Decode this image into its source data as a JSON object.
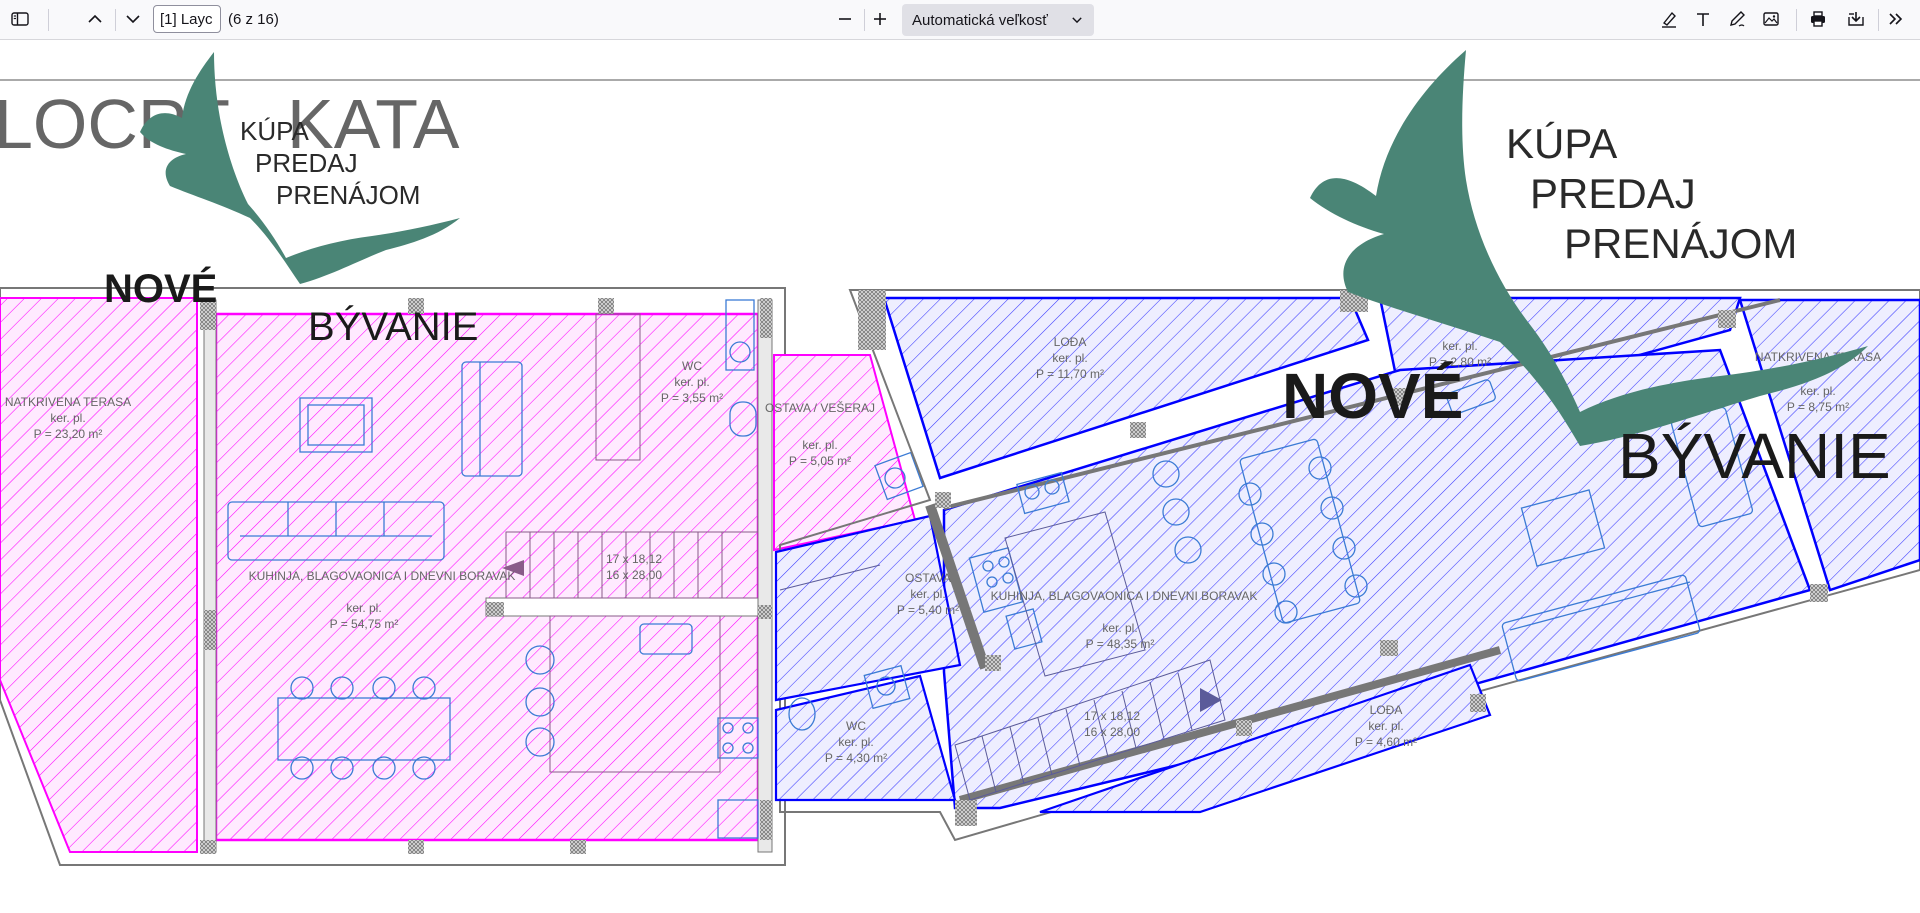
{
  "toolbar": {
    "sidebar_toggle_icon": "sidebar-icon",
    "prev_page_icon": "chevron-up-icon",
    "next_page_icon": "chevron-down-icon",
    "page_input_value": "[1] Layc",
    "page_count": "(6 z 16)",
    "zoom_out_icon": "minus-icon",
    "zoom_in_icon": "plus-icon",
    "zoom_value": "Automatická veľkosť",
    "right_tools": [
      "highlight-icon",
      "text-icon",
      "draw-icon",
      "image-icon",
      "print-icon",
      "save-icon",
      "more-tools-icon"
    ]
  },
  "document": {
    "partial_title": "LOCRT   KATA",
    "watermark": {
      "line1": "KÚPA",
      "line2": "PREDAJ",
      "line3": "PRENÁJOM",
      "brand1": "NOVÉ",
      "brand2": "BÝVANIE"
    },
    "rooms_left": [
      {
        "name": "NATKRIVENA TERASA",
        "sub": "ker. pl.",
        "area": "P = 23,20 m²"
      },
      {
        "name": "WC",
        "sub": "ker. pl.",
        "area": "P = 3,55 m²"
      },
      {
        "name": "OSTAVA / VEŠERAJ",
        "sub": "ker. pl.",
        "area": "P = 5,05 m²"
      },
      {
        "name": "17 x 18,12",
        "sub": "16 x 28,00",
        "area": ""
      },
      {
        "name": "KUHINJA, BLAGOVAONICA I DNEVNI BORAVAK",
        "sub": "ker. pl.",
        "area": "P = 54,75 m²"
      }
    ],
    "rooms_right": [
      {
        "name": "LOĐA",
        "sub": "ker. pl.",
        "area": "P = 11,70 m²"
      },
      {
        "name": "OSTAVA",
        "sub": "ker. pl.",
        "area": "P = 5,40 m²"
      },
      {
        "name": "KUHINJA, BLAGOVAONICA I DNEVNI BORAVAK",
        "sub": "ker. pl.",
        "area": "P = 48,35 m²"
      },
      {
        "name": "WC",
        "sub": "ker. pl.",
        "area": "P = 4,30 m²"
      },
      {
        "name": "17 x 18,12",
        "sub": "16 x 28,00",
        "area": ""
      },
      {
        "name": "LOĐA",
        "sub": "ker. pl.",
        "area": "P = 4,60 m²"
      },
      {
        "name": "NATKRIVENA TERASA",
        "sub": "ker. pl.",
        "area": "P = 8,75 m²"
      },
      {
        "name": "",
        "sub": "ker. pl.",
        "area": "P = 2,80 m²"
      }
    ]
  },
  "colors": {
    "toolbar_bg": "#f9f9fb",
    "magenta": "#ff00ff",
    "blue": "#0000ff",
    "watermark_green": "#4a8576",
    "brand_dark": "#1a1a1a"
  }
}
